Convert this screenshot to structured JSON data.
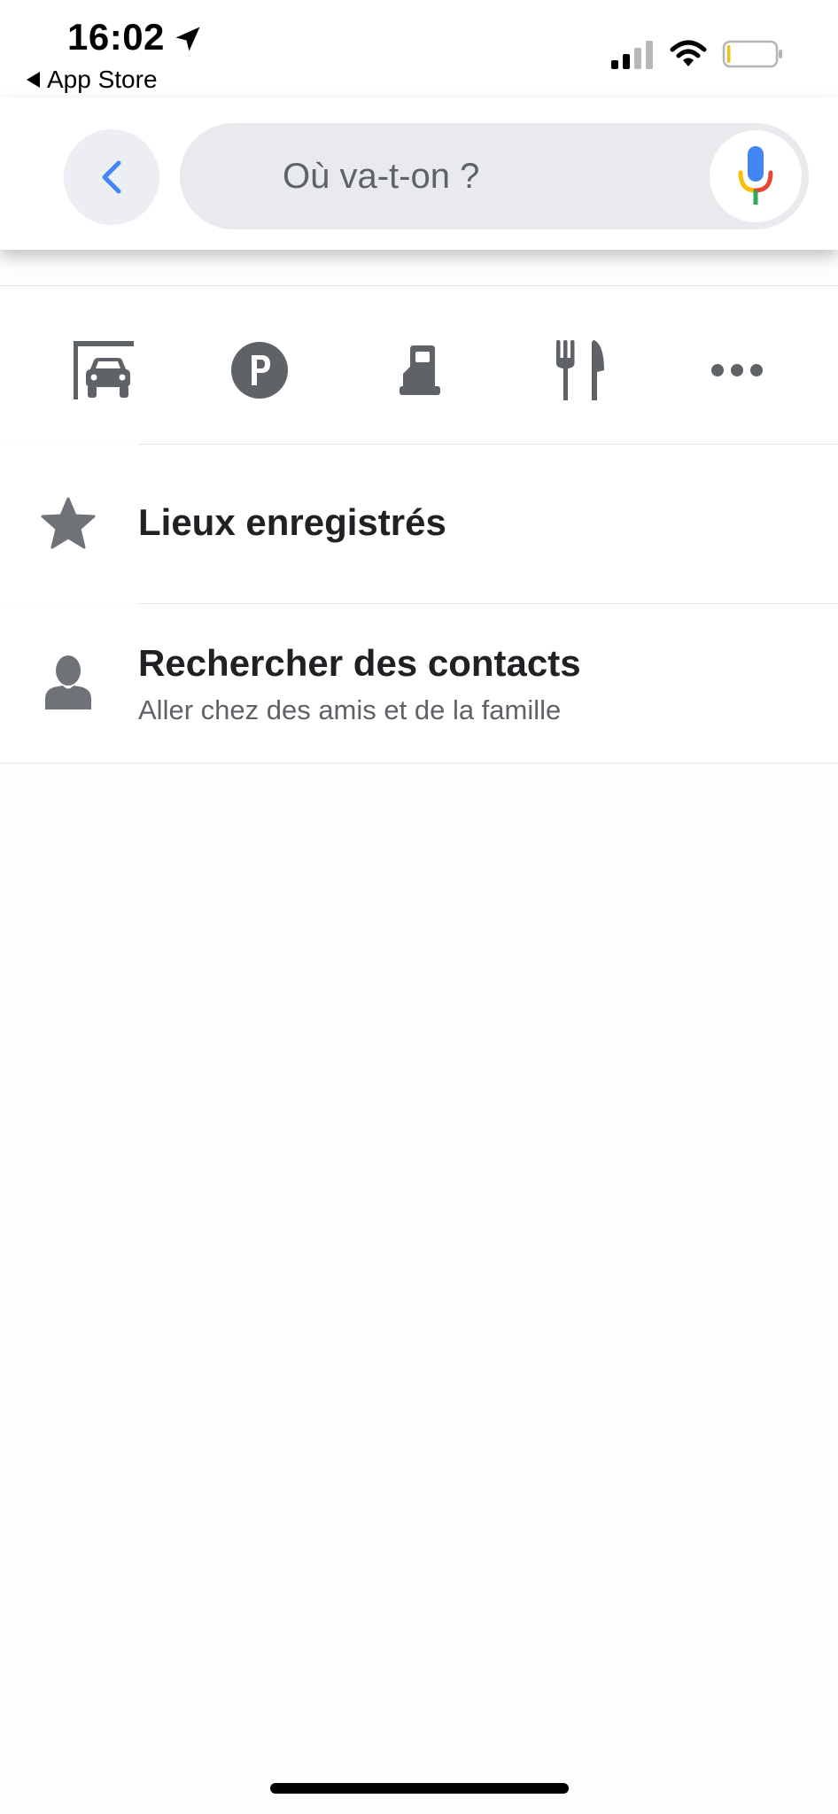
{
  "status_bar": {
    "time": "16:02",
    "back_app_label": "App Store",
    "location_icon": "location-arrow-icon",
    "signal_icon": "cellular-signal-icon",
    "wifi_icon": "wifi-icon",
    "battery_icon": "battery-low-icon",
    "battery_level": 0.05
  },
  "search": {
    "placeholder": "Où va-t-on ?",
    "back_icon": "chevron-left-icon",
    "mic_icon": "microphone-icon",
    "accent_color": "#4285f4"
  },
  "categories": [
    {
      "name": "car-wash",
      "icon": "car-wash-icon"
    },
    {
      "name": "parking",
      "icon": "parking-icon"
    },
    {
      "name": "gas-station",
      "icon": "fuel-pump-icon"
    },
    {
      "name": "restaurant",
      "icon": "fork-knife-icon"
    },
    {
      "name": "more",
      "icon": "more-dots-icon"
    }
  ],
  "list": {
    "saved": {
      "title": "Lieux enregistrés",
      "icon": "star-icon"
    },
    "contacts": {
      "title": "Rechercher des contacts",
      "subtitle": "Aller chez des amis et de la famille",
      "icon": "person-icon"
    }
  },
  "colors": {
    "icon_gray": "#5f6368",
    "title_text": "#202124",
    "mic_blue": "#4285f4",
    "mic_red": "#ea4335",
    "mic_yellow": "#fbbc04",
    "mic_green": "#34a853"
  }
}
